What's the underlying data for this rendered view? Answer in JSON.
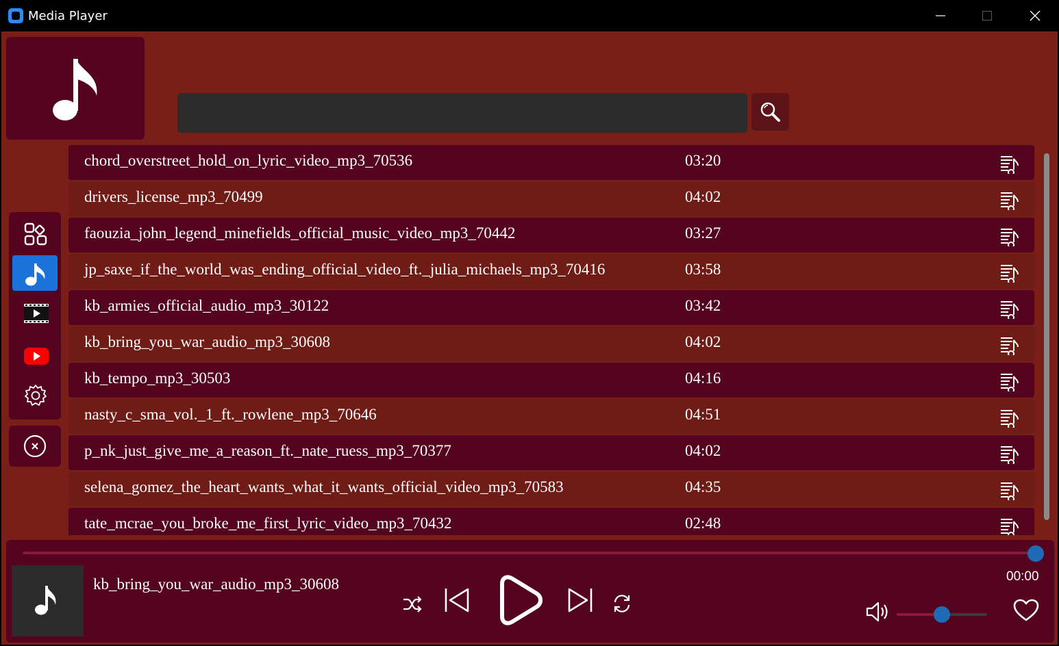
{
  "window": {
    "title": "Media Player"
  },
  "search": {
    "value": "",
    "placeholder": ""
  },
  "sidebar": {
    "items": [
      {
        "name": "dashboard-icon",
        "active": false
      },
      {
        "name": "music-note-icon",
        "active": true
      },
      {
        "name": "video-icon",
        "active": false
      },
      {
        "name": "youtube-icon",
        "active": false
      },
      {
        "name": "settings-icon",
        "active": false
      }
    ]
  },
  "playlist": {
    "tracks": [
      {
        "name": "chord_overstreet_hold_on_lyric_video_mp3_70536",
        "duration": "03:20"
      },
      {
        "name": "drivers_license_mp3_70499",
        "duration": "04:02"
      },
      {
        "name": "faouzia_john_legend_minefields_official_music_video_mp3_70442",
        "duration": "03:27"
      },
      {
        "name": "jp_saxe_if_the_world_was_ending_official_video_ft._julia_michaels_mp3_70416",
        "duration": "03:58"
      },
      {
        "name": "kb_armies_official_audio_mp3_30122",
        "duration": "03:42"
      },
      {
        "name": "kb_bring_you_war_audio_mp3_30608",
        "duration": "04:02"
      },
      {
        "name": "kb_tempo_mp3_30503",
        "duration": "04:16"
      },
      {
        "name": "nasty_c_sma_vol._1_ft._rowlene_mp3_70646",
        "duration": "04:51"
      },
      {
        "name": "p_nk_just_give_me_a_reason_ft._nate_ruess_mp3_70377",
        "duration": "04:02"
      },
      {
        "name": "selena_gomez_the_heart_wants_what_it_wants_official_video_mp3_70583",
        "duration": "04:35"
      },
      {
        "name": "tate_mcrae_you_broke_me_first_lyric_video_mp3_70432",
        "duration": "02:48"
      }
    ]
  },
  "player": {
    "now_playing": "kb_bring_you_war_audio_mp3_30608",
    "time": "00:00",
    "progress_fraction": 1.0,
    "volume_fraction": 0.5
  },
  "colors": {
    "background": "#7a1f17",
    "panel": "#550420",
    "accent": "#1a73d9",
    "knob": "#1f6bb8"
  }
}
